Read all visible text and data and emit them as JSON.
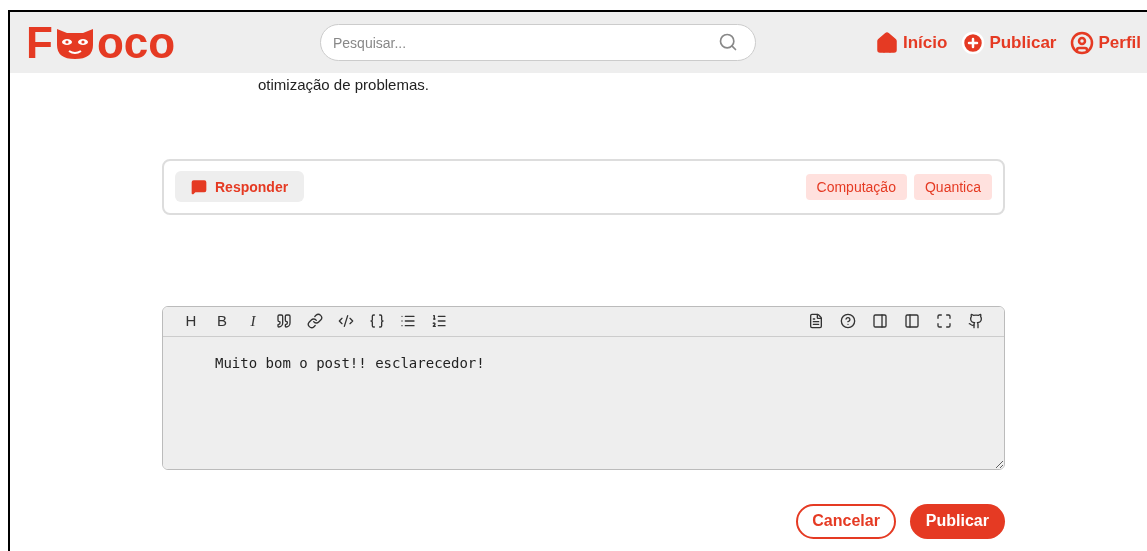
{
  "header": {
    "logo": {
      "first": "F",
      "rest": "oco"
    },
    "search": {
      "placeholder": "Pesquisar..."
    },
    "nav": [
      {
        "kind": "home",
        "label": "Início"
      },
      {
        "kind": "add",
        "label": "Publicar"
      },
      {
        "kind": "user",
        "label": "Perfil"
      }
    ]
  },
  "post": {
    "text_tail": "otimização de problemas.",
    "reply_button": "Responder",
    "tags": [
      "Computação",
      "Quantica"
    ]
  },
  "editor": {
    "format_letters": [
      {
        "label": "H",
        "kind": "heading"
      },
      {
        "label": "B",
        "kind": "bold"
      },
      {
        "label": "I",
        "kind": "italic"
      }
    ],
    "value": "Muito bom o post!! esclarecedor!"
  },
  "actions": {
    "cancel": "Cancelar",
    "submit": "Publicar"
  }
}
